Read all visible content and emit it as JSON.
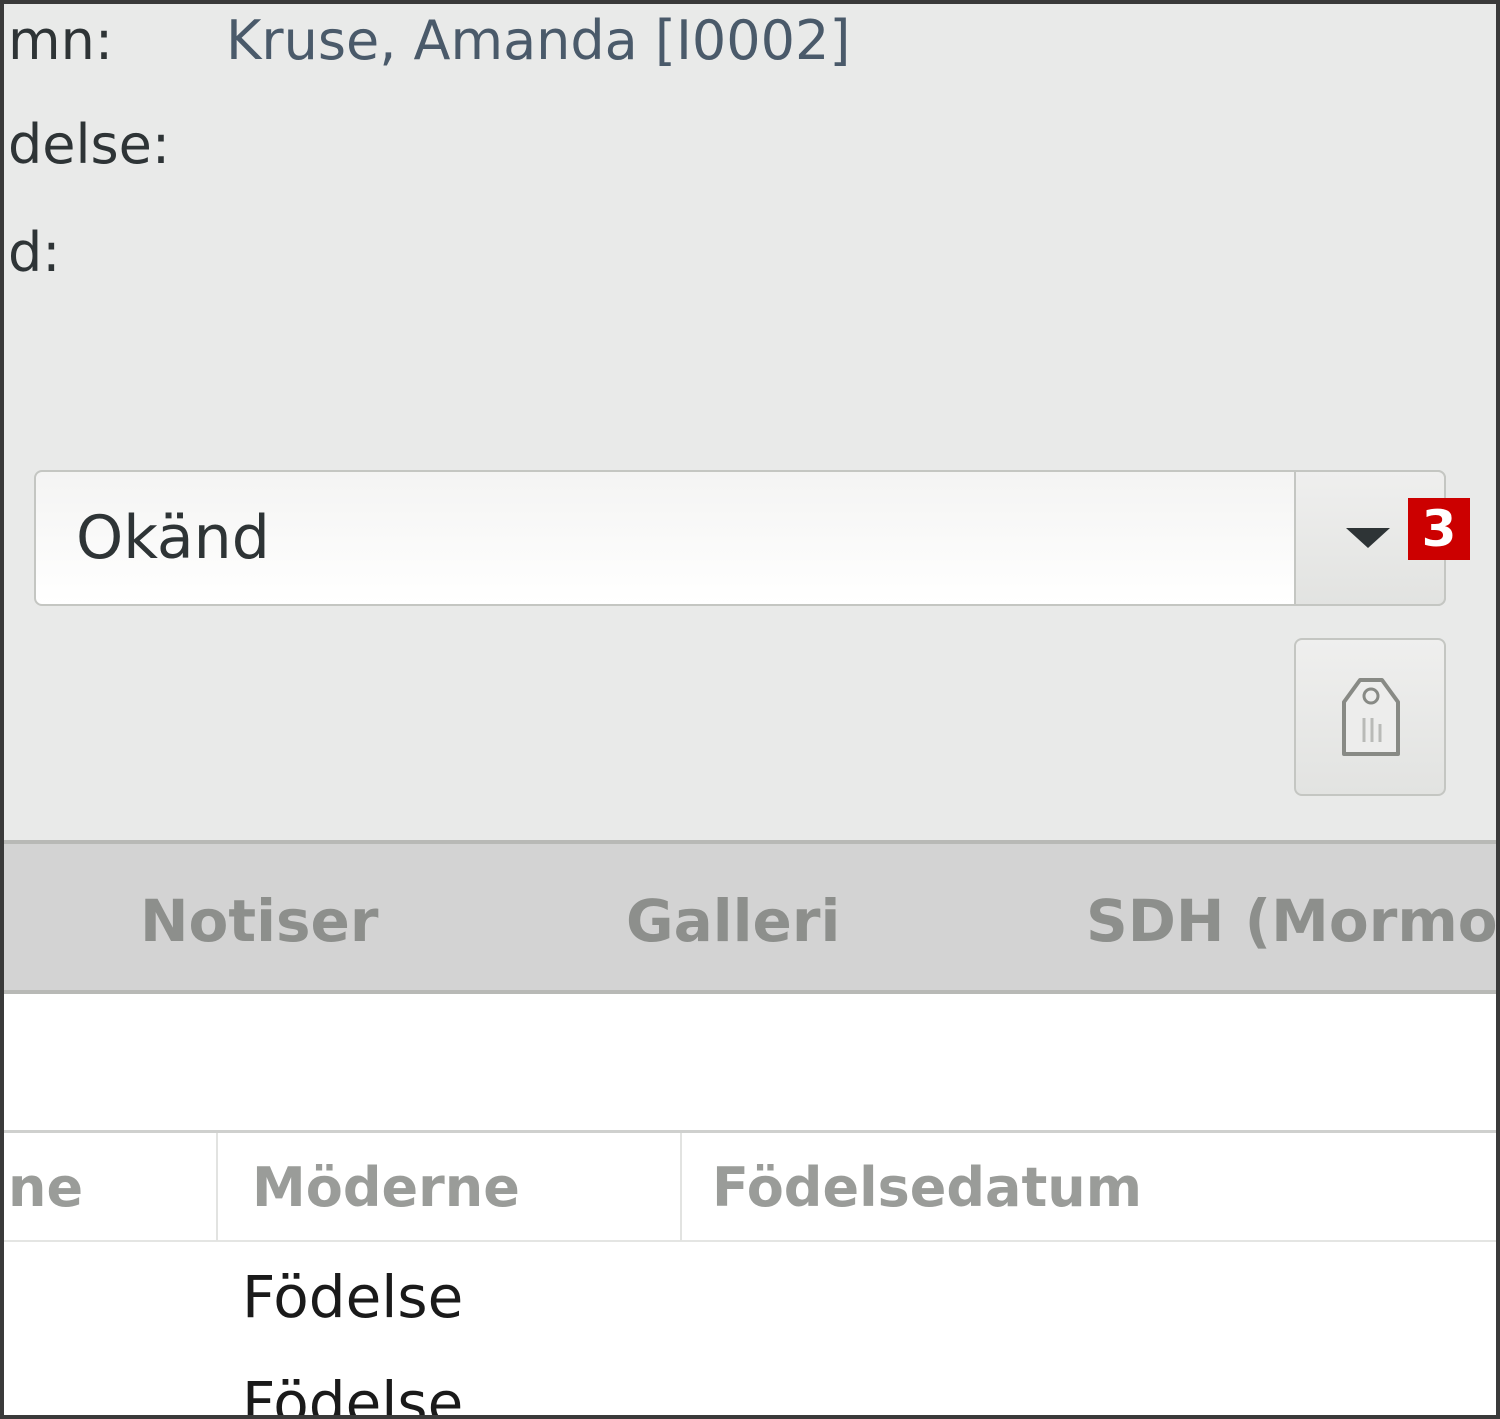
{
  "person_info": {
    "name_label": "mn:",
    "name_value": "Kruse, Amanda [I0002]",
    "birth_label": "delse:",
    "death_label": "d:"
  },
  "gender": {
    "selected": "Okänd",
    "shortcut_badge": "3"
  },
  "tags_button": {
    "icon": "tag-icon"
  },
  "tabs": [
    {
      "label": "Notiser"
    },
    {
      "label": "Galleri"
    },
    {
      "label": "SDH (Mormo"
    }
  ],
  "table": {
    "headers": [
      "ne",
      "Möderne",
      "Födelsedatum"
    ],
    "rows": [
      {
        "moderne": "Födelse"
      },
      {
        "moderne": "Födelse"
      }
    ]
  },
  "colors": {
    "badge": "#cc0000",
    "tab_bar": "#d3d3d3",
    "panel_bg": "#e9eae9"
  }
}
